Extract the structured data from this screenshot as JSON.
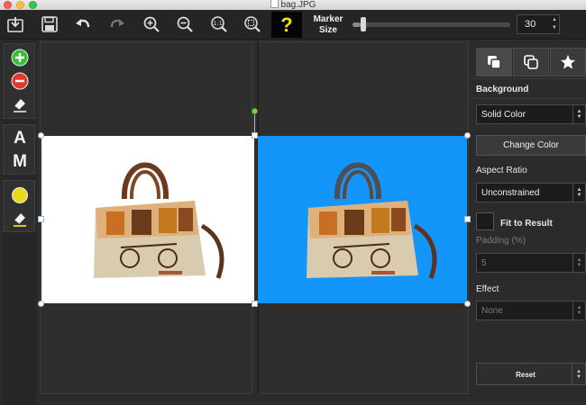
{
  "window": {
    "title": "bag.JPG"
  },
  "toolbar": {
    "help_label": "?",
    "marker_size_label": "Marker Size",
    "marker_size_value": "30",
    "marker_slider_level": 0.05,
    "icons": [
      "import-icon",
      "save-icon",
      "undo-icon",
      "redo-icon",
      "zoom-in-icon",
      "zoom-out-icon",
      "zoom-actual-icon",
      "zoom-fit-icon"
    ]
  },
  "tools": {
    "letter_a": "A",
    "letter_m": "M",
    "colors": {
      "keep": "#3dbb3c",
      "remove": "#e03a31",
      "foreground": "#e7da1b"
    }
  },
  "canvas": {
    "original_image": "bag",
    "result_background": "#1495f9"
  },
  "panel": {
    "background_heading": "Background",
    "background_type": "Solid Color",
    "change_color": "Change Color",
    "aspect_ratio_heading": "Aspect Ratio",
    "aspect_ratio_value": "Unconstrained",
    "fit_to_result": "Fit to Result",
    "padding_label": "Padding (%)",
    "padding_value": "5",
    "effect_heading": "Effect",
    "effect_value": "None",
    "reset": "Reset"
  }
}
